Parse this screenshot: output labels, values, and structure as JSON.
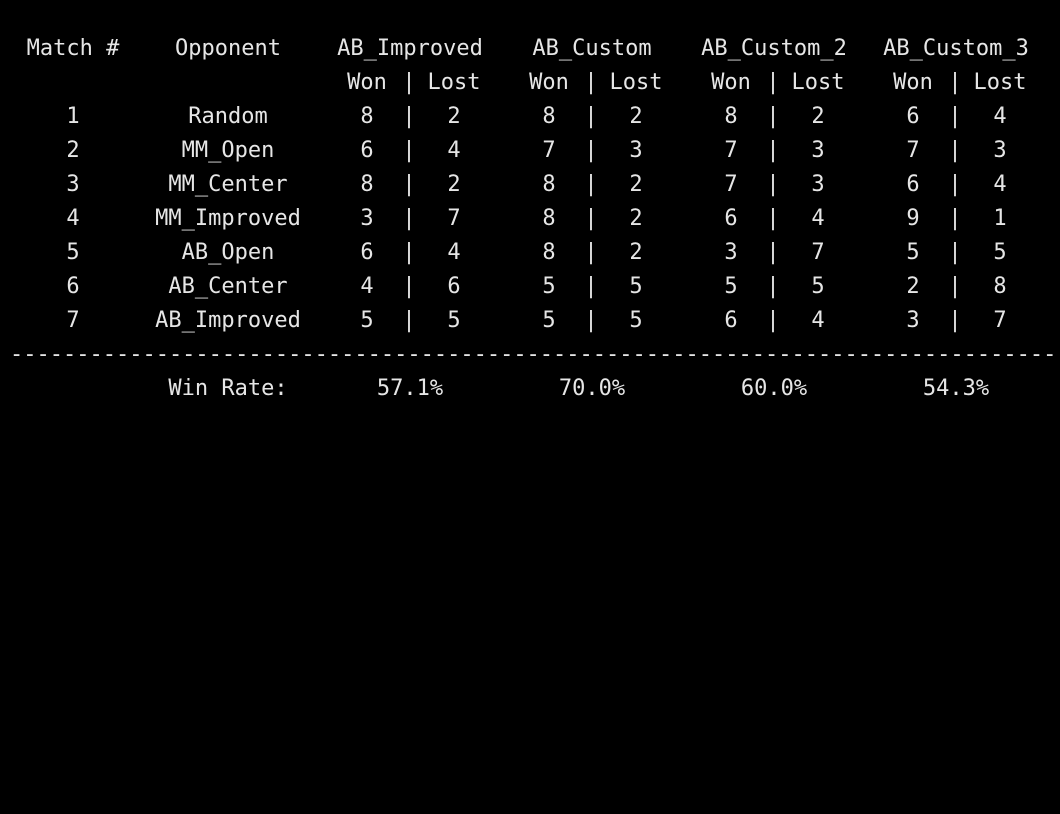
{
  "header": {
    "match_label": "Match #",
    "opponent_label": "Opponent",
    "agents": [
      "AB_Improved",
      "AB_Custom",
      "AB_Custom_2",
      "AB_Custom_3"
    ],
    "won_label": "Won",
    "separator": "|",
    "lost_label": "Lost"
  },
  "rows": [
    {
      "match": "1",
      "opponent": "Random",
      "results": [
        [
          "8",
          "2"
        ],
        [
          "8",
          "2"
        ],
        [
          "8",
          "2"
        ],
        [
          "6",
          "4"
        ]
      ]
    },
    {
      "match": "2",
      "opponent": "MM_Open",
      "results": [
        [
          "6",
          "4"
        ],
        [
          "7",
          "3"
        ],
        [
          "7",
          "3"
        ],
        [
          "7",
          "3"
        ]
      ]
    },
    {
      "match": "3",
      "opponent": "MM_Center",
      "results": [
        [
          "8",
          "2"
        ],
        [
          "8",
          "2"
        ],
        [
          "7",
          "3"
        ],
        [
          "6",
          "4"
        ]
      ]
    },
    {
      "match": "4",
      "opponent": "MM_Improved",
      "results": [
        [
          "3",
          "7"
        ],
        [
          "8",
          "2"
        ],
        [
          "6",
          "4"
        ],
        [
          "9",
          "1"
        ]
      ]
    },
    {
      "match": "5",
      "opponent": "AB_Open",
      "results": [
        [
          "6",
          "4"
        ],
        [
          "8",
          "2"
        ],
        [
          "3",
          "7"
        ],
        [
          "5",
          "5"
        ]
      ]
    },
    {
      "match": "6",
      "opponent": "AB_Center",
      "results": [
        [
          "4",
          "6"
        ],
        [
          "5",
          "5"
        ],
        [
          "5",
          "5"
        ],
        [
          "2",
          "8"
        ]
      ]
    },
    {
      "match": "7",
      "opponent": "AB_Improved",
      "results": [
        [
          "5",
          "5"
        ],
        [
          "5",
          "5"
        ],
        [
          "6",
          "4"
        ],
        [
          "3",
          "7"
        ]
      ]
    }
  ],
  "divider": "-----------------------------------------------------------------------------------------------",
  "summary": {
    "label": "Win Rate:",
    "rates": [
      "57.1%",
      "70.0%",
      "60.0%",
      "54.3%"
    ]
  },
  "colors": {
    "background": "#000000",
    "text": "#e6e6e6"
  }
}
